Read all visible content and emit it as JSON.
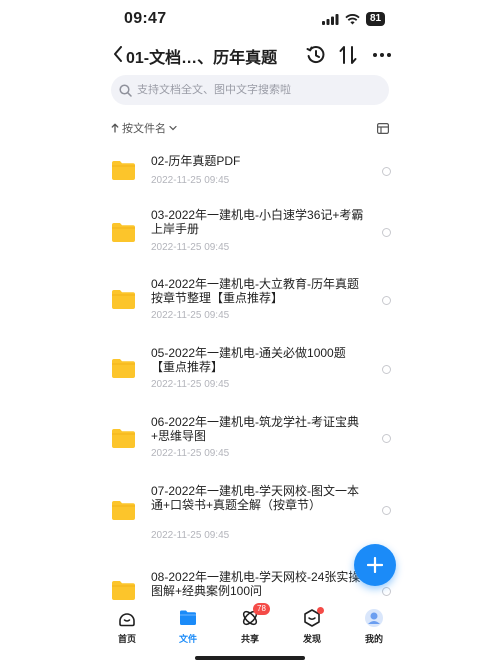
{
  "status_bar": {
    "time": "09:47",
    "battery": "81"
  },
  "header": {
    "title": "01-文档…、历年真题"
  },
  "search": {
    "placeholder": "支持文档全文、图中文字搜索啦"
  },
  "sort": {
    "label": "按文件名"
  },
  "files": [
    {
      "name": "02-历年真题PDF",
      "date": "2022-11-25 09:45"
    },
    {
      "name": "03-2022年一建机电-小白速学36记+考霸上岸手册",
      "date": "2022-11-25 09:45"
    },
    {
      "name": "04-2022年一建机电-大立教育-历年真题按章节整理【重点推荐】",
      "date": "2022-11-25 09:45"
    },
    {
      "name": "05-2022年一建机电-通关必做1000题【重点推荐】",
      "date": "2022-11-25 09:45"
    },
    {
      "name": "06-2022年一建机电-筑龙学社-考证宝典+思维导图",
      "date": "2022-11-25 09:45"
    },
    {
      "name": "07-2022年一建机电-学天网校-图文一本通+口袋书+真题全解（按章节）",
      "date": "2022-11-25 09:45"
    },
    {
      "name": "08-2022年一建机电-学天网校-24张实操图解+经典案例100问",
      "date": ""
    }
  ],
  "tabs": [
    {
      "label": "首页"
    },
    {
      "label": "文件"
    },
    {
      "label": "共享",
      "badge": "78"
    },
    {
      "label": "发现"
    },
    {
      "label": "我的"
    }
  ],
  "colors": {
    "accent": "#1b8bf8",
    "folder": "#fcc52b",
    "badge": "#f44b47"
  }
}
